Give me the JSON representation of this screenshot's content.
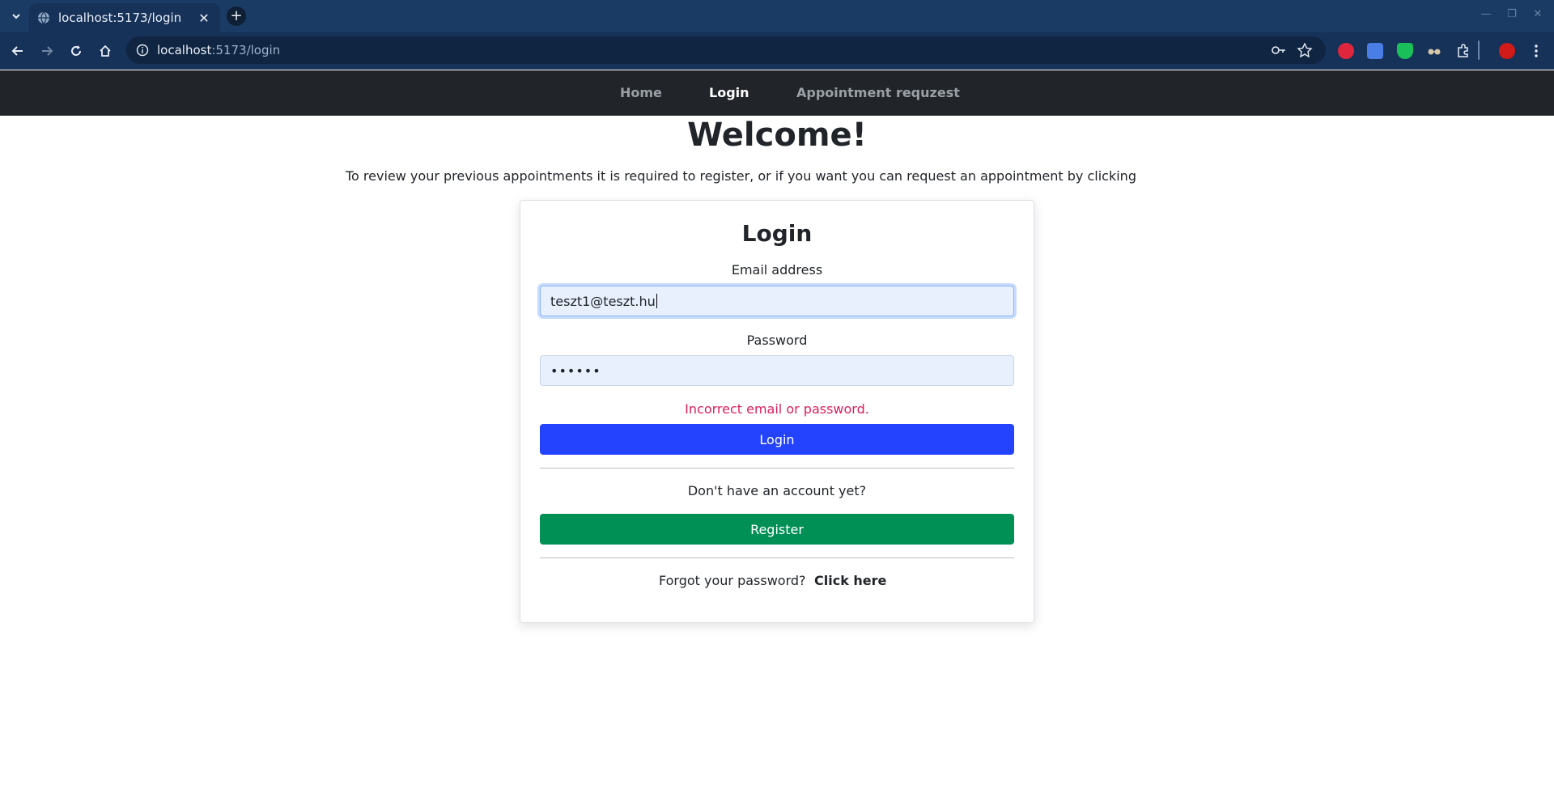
{
  "browser": {
    "tab_title": "localhost:5173/login",
    "url_host": "localhost",
    "url_path": ":5173/login",
    "new_tab_symbol": "+",
    "tab_close_symbol": "✕"
  },
  "nav": {
    "items": [
      {
        "label": "Home",
        "active": false
      },
      {
        "label": "Login",
        "active": true
      },
      {
        "label": "Appointment requzest",
        "active": false
      }
    ]
  },
  "main": {
    "title": "Welcome!",
    "intro": "To review your previous appointments it is required to register, or if you want you can request an appointment by clicking"
  },
  "login_card": {
    "heading": "Login",
    "email_label": "Email address",
    "email_value": "teszt1@teszt.hu",
    "password_label": "Password",
    "password_value": "••••••",
    "error_message": "Incorrect email or password.",
    "login_button": "Login",
    "no_account_text": "Don't have an account yet?",
    "register_button": "Register",
    "forgot_text": "Forgot your password?",
    "forgot_link": "Click here"
  },
  "colors": {
    "navbar": "#212529",
    "login_button": "#2443ff",
    "register_button": "#008f55",
    "error_text": "#dc1e5b"
  },
  "icons": [
    "tab-list-icon",
    "globe-icon",
    "close-icon",
    "new-tab-icon",
    "back-icon",
    "forward-icon",
    "reload-icon",
    "home-icon",
    "site-info-icon",
    "password-key-icon",
    "bookmark-star-icon",
    "adblock-icon",
    "translate-icon",
    "shield-icon",
    "glasses-icon",
    "extensions-icon",
    "profile-avatar",
    "menu-icon"
  ]
}
